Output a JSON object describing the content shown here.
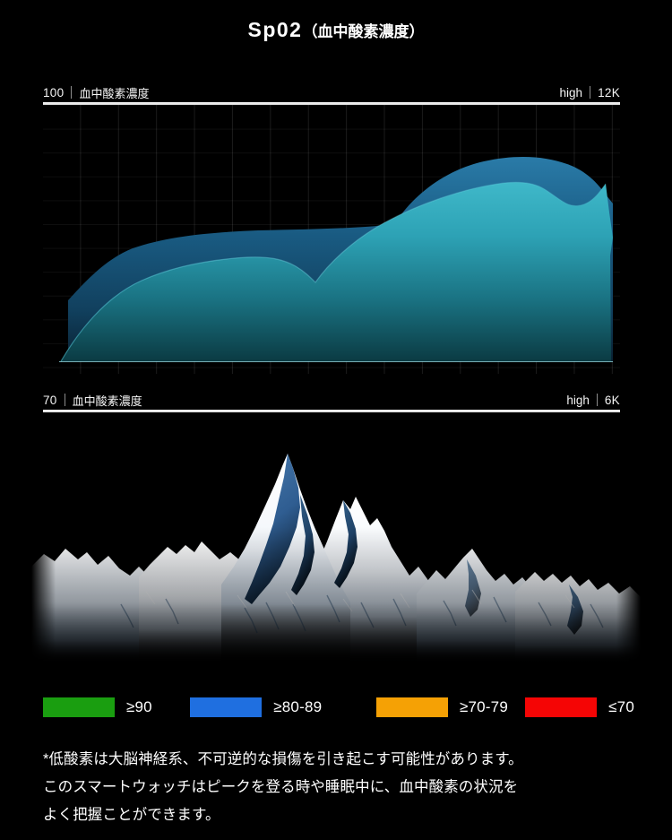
{
  "title": {
    "main": "Sp02",
    "paren": "（血中酸素濃度）"
  },
  "chart": {
    "top_axis": {
      "value": "100",
      "label": "血中酸素濃度",
      "right_word": "high",
      "right_value": "12K"
    },
    "bottom_axis": {
      "value": "70",
      "label": "血中酸素濃度",
      "right_word": "high",
      "right_value": "6K"
    }
  },
  "legend": {
    "items": [
      {
        "color": "#1a9e10",
        "label": "≥90"
      },
      {
        "color": "#1f6fe0",
        "label": "≥80-89"
      },
      {
        "color": "#f5a105",
        "label": "≥70-79"
      },
      {
        "color": "#f50505",
        "label": "≤70"
      }
    ]
  },
  "note": {
    "line1": "*低酸素は大脳神経系、不可逆的な損傷を引き起こす可能性があります。",
    "line2": "このスマートウォッチはピークを登る時や睡眠中に、血中酸素の状況を",
    "line3": "よく把握ことができます。"
  },
  "colors": {
    "background": "#000000",
    "rule": "#ffffff",
    "back_area_top": "#1c5f86",
    "back_area_bottom": "#0b2a3d",
    "front_area_top": "#35b0c2",
    "front_area_bottom": "#0d4047",
    "grid": "#ffffff",
    "text": "#ffffff"
  },
  "chart_data": {
    "type": "area",
    "title": "Sp02（血中酸素濃度）",
    "xlabel": "",
    "ylabel": "血中酸素濃度",
    "ylim": [
      70,
      100
    ],
    "y_top_label": "100",
    "y_bottom_label": "70",
    "grid": true,
    "legend_position": "bottom",
    "series": [
      {
        "name": "血中酸素濃度 (12K / high)",
        "fill": "#1c5f86",
        "x": [
          0,
          4,
          8,
          12,
          16,
          20,
          24,
          28,
          32,
          36,
          40,
          44,
          48,
          52,
          56,
          60,
          64,
          68,
          72,
          76,
          80,
          84,
          88,
          92,
          96,
          100
        ],
        "y": [
          71.0,
          77.0,
          82.5,
          85.5,
          86.8,
          87.3,
          87.6,
          87.8,
          87.9,
          88.0,
          88.1,
          88.2,
          88.3,
          89.5,
          91.5,
          93.3,
          94.6,
          95.4,
          95.8,
          95.9,
          95.9,
          95.8,
          95.2,
          93.6,
          91.8,
          90.5
        ]
      },
      {
        "name": "血中酸素濃度 (6K / high)",
        "fill": "#35b0c2",
        "x": [
          0,
          4,
          8,
          12,
          16,
          20,
          24,
          28,
          32,
          36,
          40,
          44,
          48,
          52,
          56,
          60,
          64,
          68,
          72,
          76,
          80,
          84,
          88,
          92,
          96,
          100
        ],
        "y": [
          70.0,
          76.5,
          79.8,
          81.4,
          82.3,
          82.8,
          83.0,
          83.1,
          83.0,
          82.7,
          82.2,
          83.6,
          85.6,
          87.4,
          88.9,
          90.1,
          91.0,
          91.7,
          92.2,
          92.4,
          92.0,
          91.3,
          91.5,
          92.3,
          90.4,
          87.5
        ]
      }
    ],
    "thresholds": [
      {
        "label": "≥90",
        "color": "#1a9e10"
      },
      {
        "label": "≥80-89",
        "color": "#1f6fe0"
      },
      {
        "label": "≥70-79",
        "color": "#f5a105"
      },
      {
        "label": "≤70",
        "color": "#f50505"
      }
    ]
  }
}
